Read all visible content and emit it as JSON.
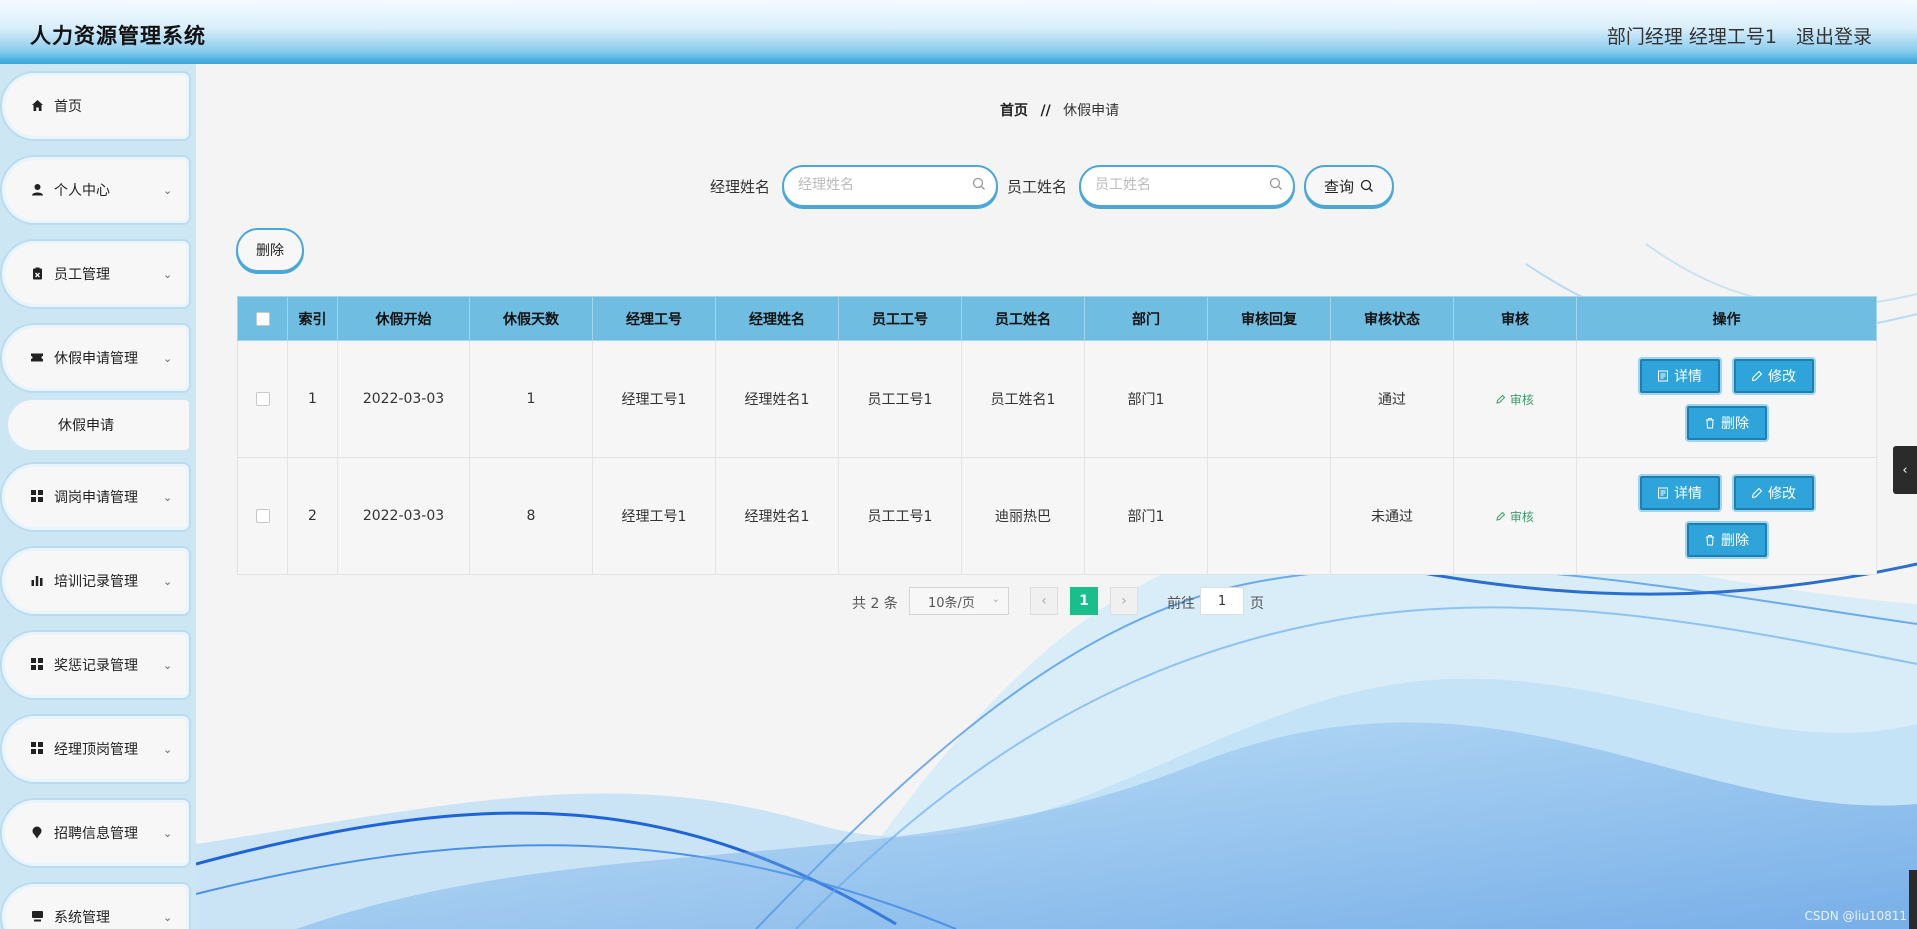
{
  "header": {
    "title": "人力资源管理系统",
    "user": "部门经理 经理工号1",
    "logout": "退出登录"
  },
  "sidebar": {
    "items": [
      {
        "label": "首页",
        "icon": "home-icon"
      },
      {
        "label": "个人中心",
        "icon": "user-icon"
      },
      {
        "label": "员工管理",
        "icon": "clipboard-icon"
      },
      {
        "label": "休假申请管理",
        "icon": "ticket-icon"
      },
      {
        "label": "调岗申请管理",
        "icon": "grid-icon"
      },
      {
        "label": "培训记录管理",
        "icon": "bar-chart-icon"
      },
      {
        "label": "奖惩记录管理",
        "icon": "grid-icon"
      },
      {
        "label": "经理顶岗管理",
        "icon": "grid-icon"
      },
      {
        "label": "招聘信息管理",
        "icon": "pin-icon"
      },
      {
        "label": "系统管理",
        "icon": "computer-icon"
      }
    ],
    "sub_item": "休假申请"
  },
  "breadcrumb": {
    "home": "首页",
    "separator": "//",
    "current": "休假申请"
  },
  "search": {
    "manager_label": "经理姓名",
    "manager_placeholder": "经理姓名",
    "employee_label": "员工姓名",
    "employee_placeholder": "员工姓名",
    "query_label": "查询"
  },
  "actions": {
    "delete_label": "删除"
  },
  "table": {
    "headers": [
      "索引",
      "休假开始",
      "休假天数",
      "经理工号",
      "经理姓名",
      "员工工号",
      "员工姓名",
      "部门",
      "审核回复",
      "审核状态",
      "审核",
      "操作"
    ],
    "rows": [
      {
        "index": "1",
        "start": "2022-03-03",
        "days": "1",
        "mgr_no": "经理工号1",
        "mgr_name": "经理姓名1",
        "emp_no": "员工工号1",
        "emp_name": "员工姓名1",
        "dept": "部门1",
        "reply": "",
        "status": "通过",
        "audit": "审核"
      },
      {
        "index": "2",
        "start": "2022-03-03",
        "days": "8",
        "mgr_no": "经理工号1",
        "mgr_name": "经理姓名1",
        "emp_no": "员工工号1",
        "emp_name": "迪丽热巴",
        "dept": "部门1",
        "reply": "",
        "status": "未通过",
        "audit": "审核"
      }
    ],
    "buttons": {
      "detail": "详情",
      "edit": "修改",
      "delete": "删除"
    }
  },
  "pagination": {
    "total": "共 2 条",
    "page_size": "10条/页",
    "current_page": "1",
    "goto_prefix": "前往",
    "goto_value": "1",
    "goto_suffix": "页"
  },
  "watermark": "CSDN @liu10811",
  "colors": {
    "accent": "#2fa4db",
    "header_bg": "#6fbde0",
    "pager_current": "#19be8a",
    "audit_link": "#3a9e6b"
  }
}
